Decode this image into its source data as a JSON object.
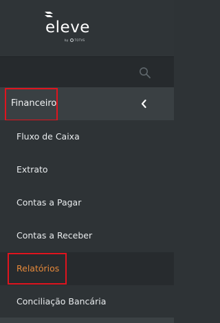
{
  "brand": {
    "wordmark": "eleve",
    "byline_prefix": "by",
    "byline_company": "TOTVS"
  },
  "search": {
    "icon": "search-icon"
  },
  "section": {
    "label": "Financeiro",
    "chevron": "chevron-left-icon"
  },
  "menu": {
    "items": [
      {
        "label": "Fluxo de Caixa"
      },
      {
        "label": "Extrato"
      },
      {
        "label": "Contas a Pagar"
      },
      {
        "label": "Contas a Receber"
      },
      {
        "label": "Relatórios",
        "active": true
      },
      {
        "label": "Conciliação Bancária"
      }
    ]
  },
  "colors": {
    "sidebar_bg": "#2e3336",
    "section_bg": "#3a4043",
    "active_text": "#e6893a",
    "highlight_border": "#e0141e"
  }
}
